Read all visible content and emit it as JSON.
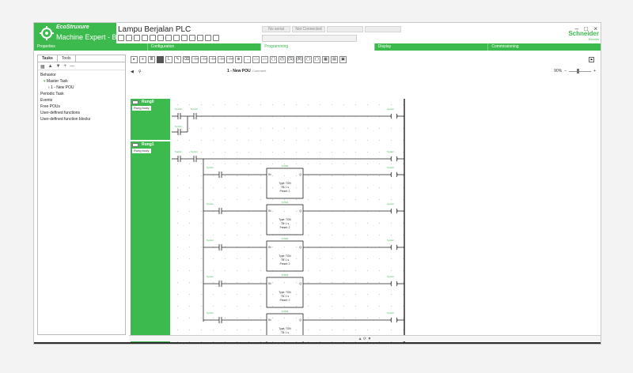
{
  "window": {
    "brand": "EcoStruxure",
    "app_name": "Machine Expert - Basic",
    "project_title": "Lampu Berjalan PLC",
    "status_mode": "No serial",
    "status_conn": "Not Connected",
    "brand_right": "Schneider",
    "brand_right_sub": "Electric",
    "colors": {
      "accent": "#3dba4e",
      "dark": "#2e2e2e"
    }
  },
  "tabs": [
    {
      "label": "Properties",
      "active": false
    },
    {
      "label": "Configuration",
      "active": false
    },
    {
      "label": "Programming",
      "active": true
    },
    {
      "label": "Display",
      "active": false
    },
    {
      "label": "Commissioning",
      "active": false
    }
  ],
  "left_panel": {
    "tabs": [
      "Tasks",
      "Tools"
    ],
    "tree": [
      "Behavior",
      "Master Task",
      "1 - New POU",
      "Periodic Task",
      "Events",
      "Free POUs",
      "User-defined functions",
      "User-defined function blocks"
    ]
  },
  "editor": {
    "pou_title": "1 - New POU",
    "pou_comment": "Comment",
    "zoom": "90%",
    "rungs": [
      {
        "name": "Rung0",
        "lang": "Rung body"
      },
      {
        "name": "Rung1",
        "lang": "Rung body"
      }
    ],
    "labels": {
      "symbol": "Symbol",
      "comment": "Comment",
      "in": "IN",
      "q": "Q",
      "type": "Type: TON",
      "tb": "TB: 1 s",
      "preset": "Preset: 2",
      "blocks": [
        "%TM0",
        "%TM1",
        "%TM2",
        "%TM3",
        "%TM4"
      ]
    }
  }
}
